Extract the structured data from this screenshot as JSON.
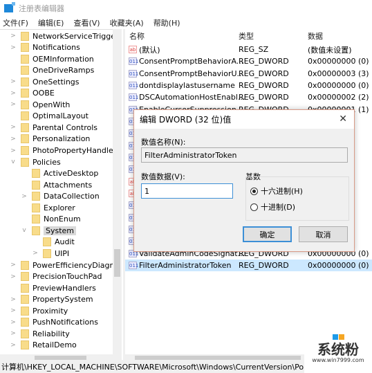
{
  "window": {
    "title": "注册表编辑器"
  },
  "menu": [
    "文件(F)",
    "编辑(E)",
    "查看(V)",
    "收藏夹(A)",
    "帮助(H)"
  ],
  "tree": [
    {
      "label": "NetworkServiceTrigger",
      "level": 1,
      "expander": ">"
    },
    {
      "label": "Notifications",
      "level": 1,
      "expander": ">"
    },
    {
      "label": "OEMInformation",
      "level": 1,
      "expander": ""
    },
    {
      "label": "OneDriveRamps",
      "level": 1,
      "expander": ""
    },
    {
      "label": "OneSettings",
      "level": 1,
      "expander": ">"
    },
    {
      "label": "OOBE",
      "level": 1,
      "expander": ">"
    },
    {
      "label": "OpenWith",
      "level": 1,
      "expander": ">"
    },
    {
      "label": "OptimalLayout",
      "level": 1,
      "expander": ""
    },
    {
      "label": "Parental Controls",
      "level": 1,
      "expander": ">"
    },
    {
      "label": "Personalization",
      "level": 1,
      "expander": ">"
    },
    {
      "label": "PhotoPropertyHandler",
      "level": 1,
      "expander": ">"
    },
    {
      "label": "Policies",
      "level": 1,
      "expander": "v"
    },
    {
      "label": "ActiveDesktop",
      "level": 2,
      "expander": ""
    },
    {
      "label": "Attachments",
      "level": 2,
      "expander": ""
    },
    {
      "label": "DataCollection",
      "level": 2,
      "expander": ">"
    },
    {
      "label": "Explorer",
      "level": 2,
      "expander": ""
    },
    {
      "label": "NonEnum",
      "level": 2,
      "expander": ""
    },
    {
      "label": "System",
      "level": 2,
      "expander": "v",
      "selected": true
    },
    {
      "label": "Audit",
      "level": 3,
      "expander": ""
    },
    {
      "label": "UIPI",
      "level": 3,
      "expander": ">"
    },
    {
      "label": "PowerEfficiencyDiagnos",
      "level": 1,
      "expander": ">"
    },
    {
      "label": "PrecisionTouchPad",
      "level": 1,
      "expander": ">"
    },
    {
      "label": "PreviewHandlers",
      "level": 1,
      "expander": ""
    },
    {
      "label": "PropertySystem",
      "level": 1,
      "expander": ">"
    },
    {
      "label": "Proximity",
      "level": 1,
      "expander": ">"
    },
    {
      "label": "PushNotifications",
      "level": 1,
      "expander": ">"
    },
    {
      "label": "Reliability",
      "level": 1,
      "expander": ">"
    },
    {
      "label": "RetailDemo",
      "level": 1,
      "expander": ">"
    }
  ],
  "list": {
    "headers": {
      "name": "名称",
      "type": "类型",
      "data": "数据"
    },
    "rows": [
      {
        "icon": "sz",
        "name": "(默认)",
        "type": "REG_SZ",
        "data": "(数值未设置)"
      },
      {
        "icon": "dw",
        "name": "ConsentPromptBehaviorA...",
        "type": "REG_DWORD",
        "data": "0x00000000 (0)"
      },
      {
        "icon": "dw",
        "name": "ConsentPromptBehaviorU...",
        "type": "REG_DWORD",
        "data": "0x00000003 (3)"
      },
      {
        "icon": "dw",
        "name": "dontdisplaylastusername",
        "type": "REG_DWORD",
        "data": "0x00000000 (0)"
      },
      {
        "icon": "dw",
        "name": "DSCAutomationHostEnabl...",
        "type": "REG_DWORD",
        "data": "0x00000002 (2)"
      },
      {
        "icon": "dw",
        "name": "EnableCursorSuppression",
        "type": "REG_DWORD",
        "data": "0x00000001 (1)"
      },
      {
        "icon": "dw",
        "name": "",
        "type": "",
        "data": ""
      },
      {
        "icon": "dw",
        "name": "",
        "type": "",
        "data": ""
      },
      {
        "icon": "dw",
        "name": "",
        "type": "",
        "data": ""
      },
      {
        "icon": "dw",
        "name": "",
        "type": "",
        "data": ""
      },
      {
        "icon": "dw",
        "name": "",
        "type": "",
        "data": ""
      },
      {
        "icon": "sz",
        "name": "",
        "type": "",
        "data": ""
      },
      {
        "icon": "sz",
        "name": "",
        "type": "",
        "data": ""
      },
      {
        "icon": "dw",
        "name": "",
        "type": "",
        "data": ""
      },
      {
        "icon": "dw",
        "name": "",
        "type": "",
        "data": ""
      },
      {
        "icon": "dw",
        "name": "",
        "type": "",
        "data": ""
      },
      {
        "icon": "dw",
        "name": "",
        "type": "",
        "data": ""
      },
      {
        "icon": "dw",
        "name": "ValidateAdminCodeSignat...",
        "type": "REG_DWORD",
        "data": "0x00000000 (0)"
      },
      {
        "icon": "dw",
        "name": "FilterAdministratorToken",
        "type": "REG_DWORD",
        "data": "0x00000000 (0)",
        "highlight": true
      }
    ]
  },
  "status": {
    "path": "计算机\\HKEY_LOCAL_MACHINE\\SOFTWARE\\Microsoft\\Windows\\CurrentVersion\\Poli"
  },
  "watermark": {
    "text": "系统粉",
    "url": "www.win7999.com"
  },
  "dialog": {
    "title": "编辑 DWORD (32 位)值",
    "close": "✕",
    "name_label": "数值名称(N):",
    "name_value": "FilterAdministratorToken",
    "data_label": "数值数据(V):",
    "data_value": "1",
    "base_label": "基数",
    "hex_label": "十六进制(H)",
    "dec_label": "十进制(D)",
    "base_selected": "hex",
    "ok": "确定",
    "cancel": "取消"
  }
}
